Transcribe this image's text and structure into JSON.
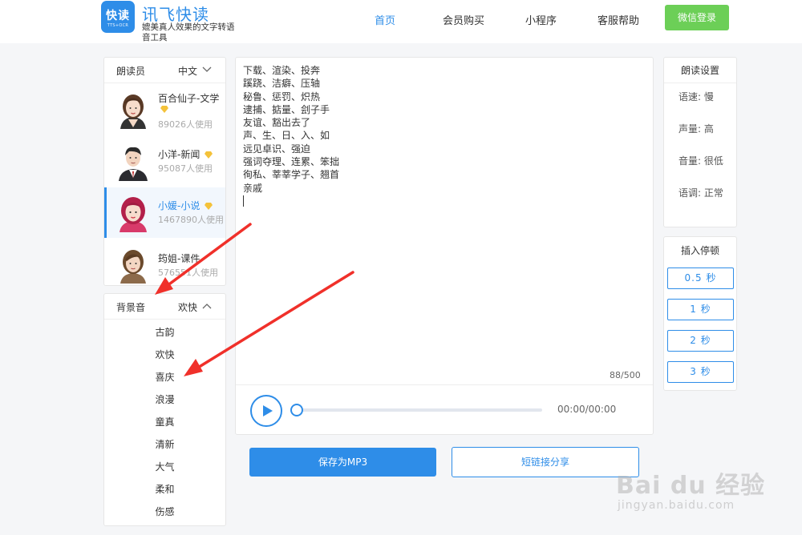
{
  "header": {
    "logo_text": "快读",
    "logo_sub": "TTS+OCR",
    "brand_title": "讯飞快读",
    "brand_subtitle": "媲美真人效果的文字转语音工具",
    "nav": [
      {
        "label": "首页",
        "active": true
      },
      {
        "label": "会员购买",
        "active": false
      },
      {
        "label": "小程序",
        "active": false
      },
      {
        "label": "客服帮助",
        "active": false
      }
    ],
    "login_label": "微信登录"
  },
  "reader_panel": {
    "label": "朗读员",
    "language": "中文",
    "voices": [
      {
        "name": "百合仙子-文学",
        "uses": "89026人使用",
        "premium": true,
        "selected": false
      },
      {
        "name": "小洋-新闻",
        "uses": "95087人使用",
        "premium": true,
        "selected": false
      },
      {
        "name": "小媛-小说",
        "uses": "1467890人使用",
        "premium": true,
        "selected": true
      },
      {
        "name": "筠姐-课件",
        "uses": "576551人使用",
        "premium": false,
        "selected": false
      }
    ]
  },
  "bgm_panel": {
    "label": "背景音",
    "selected": "欢快",
    "options": [
      "古韵",
      "欢快",
      "喜庆",
      "浪漫",
      "童真",
      "清新",
      "大气",
      "柔和",
      "伤感"
    ]
  },
  "editor": {
    "lines": [
      "下载、渲染、投奔",
      "蹊跷、洁癖、压轴",
      "秘鲁、惩罚、炽热",
      "逮捕、掂量、刽子手",
      "友谊、豁出去了",
      "声、生、日、入、如",
      "远见卓识、强迫",
      "强词夺理、连累、笨拙",
      "徇私、莘莘学子、翘首",
      "亲戚"
    ],
    "char_count": "88/500",
    "time": "00:00/00:00",
    "progress": 0
  },
  "actions": {
    "save_mp3": "保存为MP3",
    "share_link": "短链接分享"
  },
  "settings": {
    "title": "朗读设置",
    "rows": [
      "语速: 慢",
      "声量: 高",
      "音量: 很低",
      "语调: 正常"
    ]
  },
  "pause_panel": {
    "title": "插入停顿",
    "buttons": [
      "0.5 秒",
      "1 秒",
      "2 秒",
      "3 秒"
    ]
  },
  "watermark": {
    "main": "Bai du 经验",
    "sub": "jingyan.baidu.com"
  },
  "colors": {
    "accent": "#2e8de8",
    "login_green": "#6ccf57",
    "annotation_red": "#f0302a"
  }
}
